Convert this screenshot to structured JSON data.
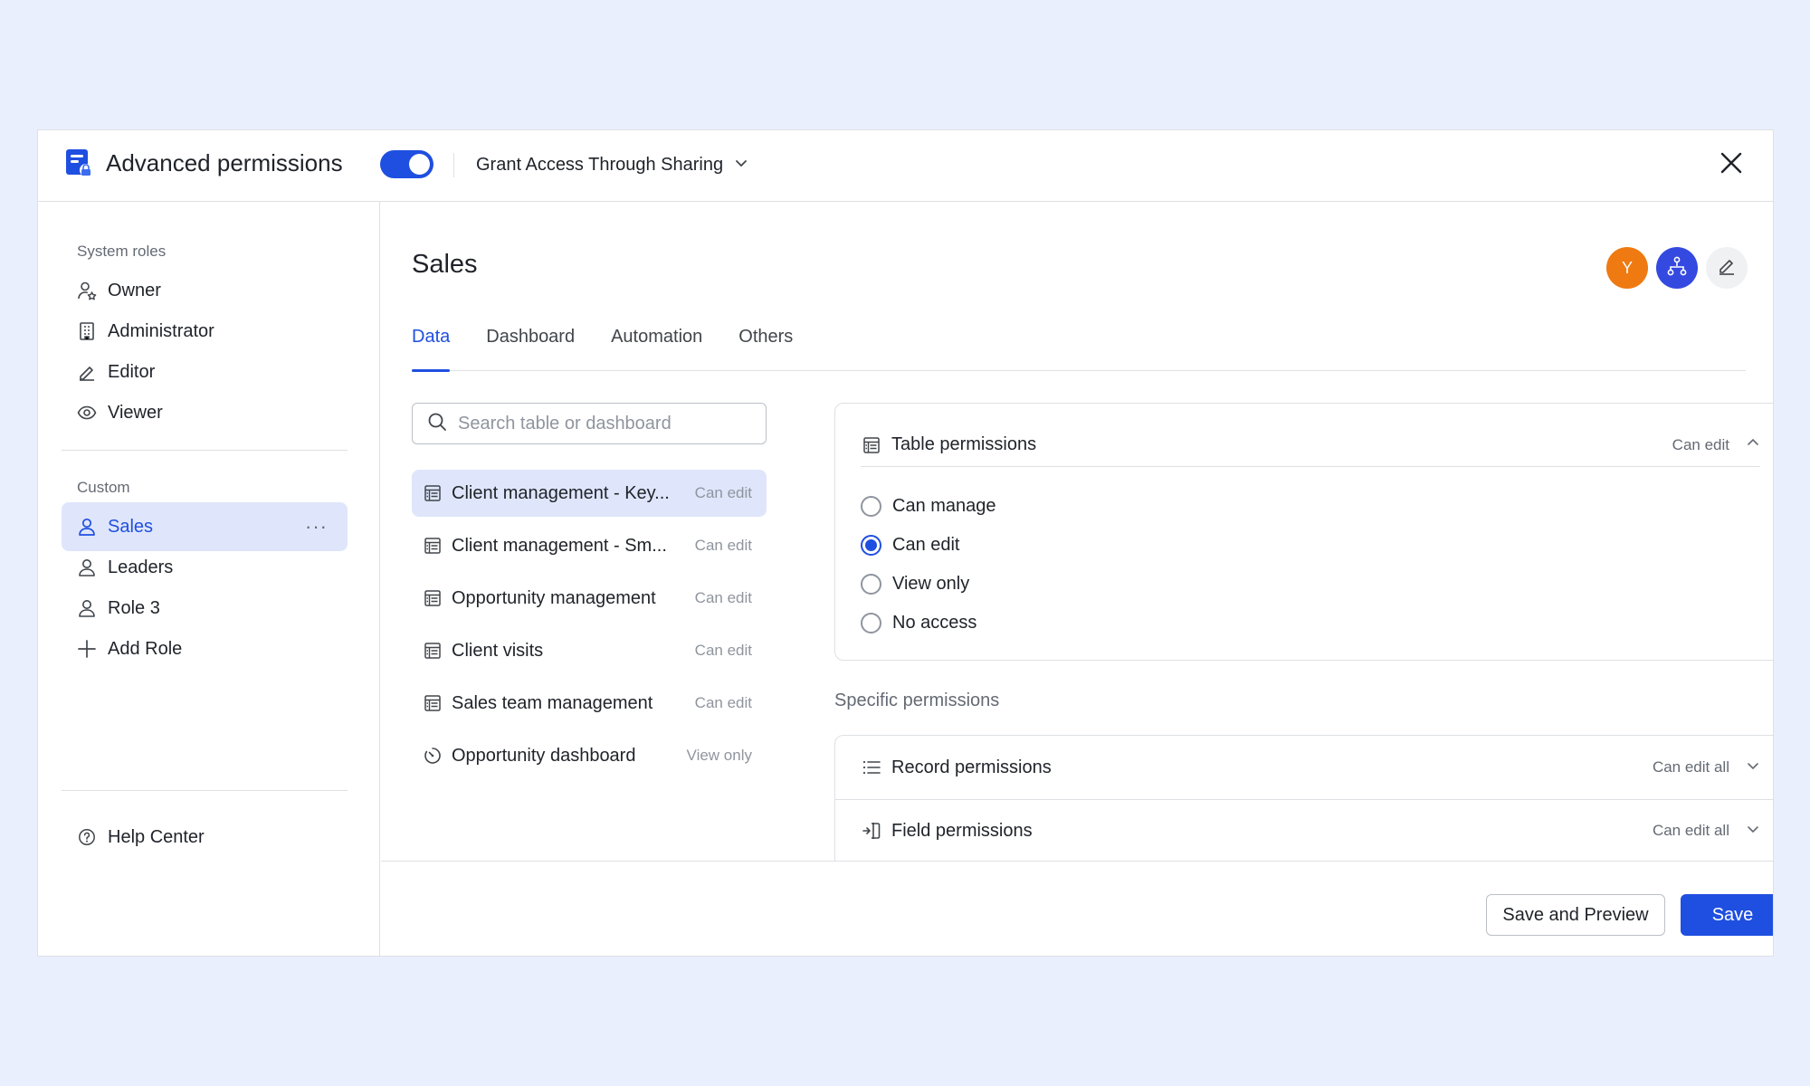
{
  "header": {
    "title": "Advanced permissions",
    "toggle_on": true,
    "grant_label": "Grant Access Through Sharing",
    "icons": {
      "app": "permissions-app-icon",
      "dropdown": "chevron-down-icon",
      "close": "close-icon"
    }
  },
  "sidebar": {
    "system_label": "System roles",
    "system_roles": [
      {
        "label": "Owner",
        "icon": "owner-icon"
      },
      {
        "label": "Administrator",
        "icon": "building-icon"
      },
      {
        "label": "Editor",
        "icon": "pencil-icon"
      },
      {
        "label": "Viewer",
        "icon": "eye-icon"
      }
    ],
    "custom_label": "Custom",
    "custom_roles": [
      {
        "label": "Sales",
        "icon": "user-icon",
        "active": true
      },
      {
        "label": "Leaders",
        "icon": "user-icon"
      },
      {
        "label": "Role 3",
        "icon": "user-icon"
      }
    ],
    "more_label": "···",
    "add_role": "Add Role",
    "help": "Help Center"
  },
  "main": {
    "role_title": "Sales",
    "avatar_initial": "Y",
    "tabs": [
      {
        "label": "Data",
        "active": true
      },
      {
        "label": "Dashboard"
      },
      {
        "label": "Automation"
      },
      {
        "label": "Others"
      }
    ],
    "search": {
      "placeholder": "Search table or dashboard",
      "value": ""
    },
    "items": [
      {
        "name": "Client management - Key...",
        "perm": "Can edit",
        "icon": "table-icon",
        "active": true
      },
      {
        "name": "Client management - Sm...",
        "perm": "Can edit",
        "icon": "table-icon"
      },
      {
        "name": "Opportunity management",
        "perm": "Can edit",
        "icon": "table-icon"
      },
      {
        "name": "Client visits",
        "perm": "Can edit",
        "icon": "table-icon"
      },
      {
        "name": "Sales team management",
        "perm": "Can edit",
        "icon": "table-icon"
      },
      {
        "name": "Opportunity dashboard",
        "perm": "View only",
        "icon": "dashboard-icon"
      }
    ],
    "table_permissions": {
      "title": "Table permissions",
      "value": "Can edit",
      "options": [
        {
          "label": "Can manage",
          "checked": false
        },
        {
          "label": "Can edit",
          "checked": true
        },
        {
          "label": "View only",
          "checked": false
        },
        {
          "label": "No access",
          "checked": false
        }
      ]
    },
    "specific_label": "Specific permissions",
    "record_permissions": {
      "title": "Record permissions",
      "value": "Can edit all"
    },
    "field_permissions": {
      "title": "Field permissions",
      "value": "Can edit all"
    }
  },
  "footer": {
    "preview_label": "Save and Preview",
    "save_label": "Save"
  },
  "colors": {
    "accent": "#1f4fe0",
    "avatar_orange": "#ef7a11",
    "avatar_blue": "#3449e0"
  }
}
